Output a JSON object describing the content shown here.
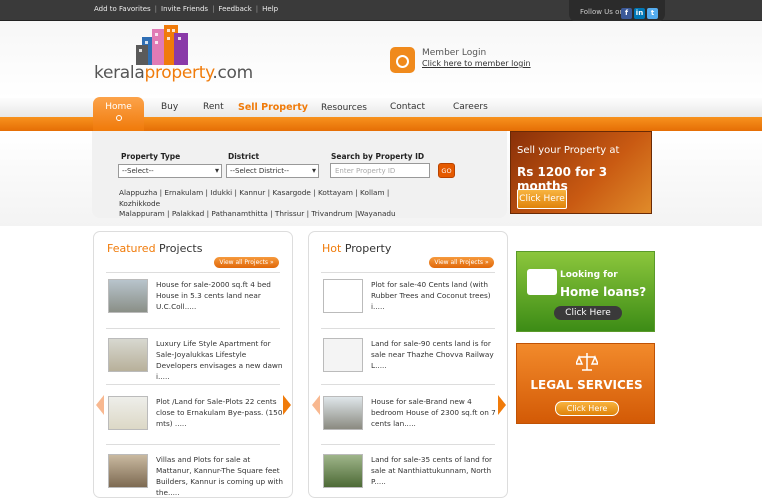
{
  "toplinks": [
    "Add to Favorites",
    "Invite Friends",
    "Feedback",
    "Help"
  ],
  "follow": {
    "label": "Follow Us on :",
    "icons": [
      "facebook-icon",
      "linkedin-icon",
      "twitter-icon"
    ]
  },
  "logo": {
    "part1": "kerala",
    "part2": "property",
    "part3": ".com"
  },
  "member": {
    "title": "Member Login",
    "link": "Click here to member login"
  },
  "nav": [
    "Home",
    "Buy",
    "Rent",
    "Sell Property",
    "Resources",
    "Contact",
    "Careers"
  ],
  "search": {
    "type_label": "Property Type",
    "type_value": "--Select--",
    "district_label": "District",
    "district_value": "--Select District--",
    "id_label": "Search by Property ID",
    "id_placeholder": "Enter Property ID",
    "go": "GO",
    "districts_line1": "Alappuzha | Ernakulam | Idukki | Kannur | Kasargode | Kottayam | Kollam | Kozhikkode",
    "districts_line2": "Malappuram | Palakkad | Pathanamthitta | Thrissur | Trivandrum |Wayanadu"
  },
  "ad1": {
    "line1": "Sell your Property at",
    "line2": "Rs 1200 for 3 months",
    "button": "Click Here"
  },
  "featured": {
    "title_a": "Featured",
    "title_b": " Projects",
    "viewall": "View all Projects »",
    "items": [
      "House for sale-2000 sq.ft 4 bed House in 5.3 cents land near U.C.Coll.....",
      "Luxury Life Style Apartment for Sale-Joyalukkas Lifestyle Developers envisages a new dawn i.....",
      "Plot /Land for Sale-Plots 22 cents close to Ernakulam Bye-pass. (150 mts) .....",
      "Villas and Plots for sale at Mattanur, Kannur-The Square feet Builders, Kannur is coming up with the....."
    ]
  },
  "hot": {
    "title_a": "Hot",
    "title_b": " Property",
    "viewall": "View all Projects »",
    "items": [
      "Plot for sale-40 Cents land (with Rubber Trees and Coconut trees) i.....",
      "Land for sale-90 cents land is for sale near Thazhe Chovva Railway L.....",
      "House for sale-Brand new 4 bedroom House of 2300 sq.ft on 7 cents lan.....",
      "Land for sale-35 cents of land for sale at Nanthiattukunnam, North P....."
    ]
  },
  "ad2": {
    "line1": "Looking for",
    "line2": "Home loans?",
    "button": "Click Here"
  },
  "ad3": {
    "line1": "LEGAL SERVICES",
    "button": "Click Here"
  }
}
